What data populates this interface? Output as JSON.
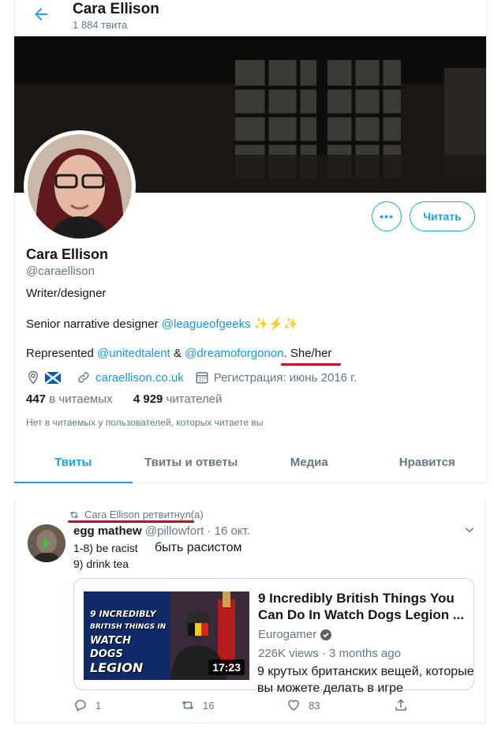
{
  "header": {
    "title": "Cara Ellison",
    "subtitle": "1 884 твита"
  },
  "profile": {
    "more_label": "•••",
    "follow_label": "Читать",
    "name": "Cara Ellison",
    "handle": "@caraellison",
    "bio": {
      "line1": "Writer/designer",
      "line2_text": "Senior narrative designer ",
      "line2_link": "@leagueofgeeks",
      "line2_emoji": " ✨⚡✨",
      "line3_text": "Represented ",
      "line3_link1": "@unitedtalent",
      "line3_amp": " & ",
      "line3_link2": "@dreamoforgonon",
      "line3_end": ". She/her"
    },
    "website": "caraellison.co.uk",
    "joined": "Регистрация: июнь 2016 г.",
    "following_count": "447",
    "following_label": "в читаемых",
    "followers_count": "4 929",
    "followers_label": "читателей",
    "followed_note": "Нет в читаемых у пользователей, которых читаете вы"
  },
  "tabs": [
    {
      "label": "Твиты",
      "active": true
    },
    {
      "label": "Твиты и ответы",
      "active": false
    },
    {
      "label": "Медиа",
      "active": false
    },
    {
      "label": "Нравится",
      "active": false
    }
  ],
  "tweet": {
    "retweet_label": "Cara Ellison ретвитнул(а)",
    "author_name": "egg mathew",
    "author_handle": "@pillowfort",
    "date": "· 16 окт.",
    "line1": "1-8) be racist",
    "line1_annotation": "быть расистом",
    "line2": "9) drink tea",
    "card": {
      "title": "9 Incredibly British Things You Can Do In Watch Dogs Legion ...",
      "site": "Eurogamer",
      "views": "226K views · 3 months ago",
      "duration": "17:23",
      "thumb_text": [
        "9 INCREDIBLY",
        "BRITISH THINGS IN",
        "WATCH DOGS",
        "LEGION"
      ]
    },
    "card_annotation": "9 крутых британских вещей, которые вы можете делать в игре",
    "replies": "1",
    "retweets": "16",
    "likes": "83"
  }
}
